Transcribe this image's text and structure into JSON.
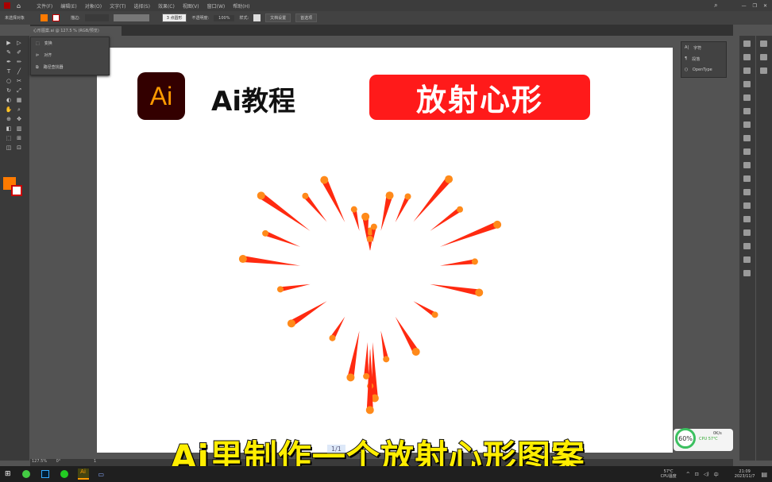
{
  "menubar": {
    "items": [
      "文件(F)",
      "编辑(E)",
      "对象(O)",
      "文字(T)",
      "选择(S)",
      "效果(C)",
      "视图(V)",
      "窗口(W)",
      "帮助(H)"
    ]
  },
  "control_bar": {
    "selection": "未选择对象",
    "stroke_label": "描边:",
    "point_shape": "3 点圆形",
    "opacity_label": "不透明度:",
    "opacity": "100%",
    "style_label": "样式:",
    "doc_setup": "文档设置",
    "preferences": "首选项",
    "fill_color": "#ff7a00"
  },
  "document_tab": {
    "title": "心形图案.ai @ 127.5 % (RGB/预览)"
  },
  "popup_panel": {
    "items": [
      "变换",
      "对齐",
      "路径查找器"
    ]
  },
  "char_panel": {
    "items": [
      "字符",
      "段落",
      "OpenType"
    ]
  },
  "artboard": {
    "logo_text": "Ai",
    "tutorial": "Ai教程",
    "badge": "放射心形",
    "ray_color": "#ff2a10",
    "dot_color": "#ff8a1a",
    "ray_count": 28
  },
  "subtitle": "Ai里制作一个放射心形图案",
  "page_indicator": "1/1",
  "statusbar": {
    "zoom": "127.5%",
    "rotation": "0°",
    "page": "1"
  },
  "widget": {
    "cpu_percent": "60%",
    "cpu_temp": "CPU 57℃",
    "speed": "0K/s"
  },
  "taskbar": {
    "temp": "57℃",
    "temp_label": "CPU温度",
    "ime": "中",
    "time": "21:09",
    "date": "2023/11/7"
  }
}
